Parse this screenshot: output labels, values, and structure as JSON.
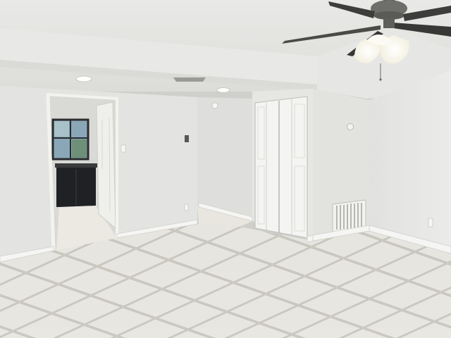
{
  "scene": {
    "subject": "empty-room-interior",
    "colors": {
      "wall": "#e4e4e1",
      "wall_shadow": "#d2d3d0",
      "ceiling": "#ececea",
      "floor_tile": "#e6e5df",
      "grout": "#b9b7ae",
      "baseboard": "#f4f4f2",
      "door": "#f3f3f1",
      "cabinet": "#1f2124",
      "fan_blade": "#3d3d3d",
      "light_glow": "#fffdf2"
    }
  }
}
